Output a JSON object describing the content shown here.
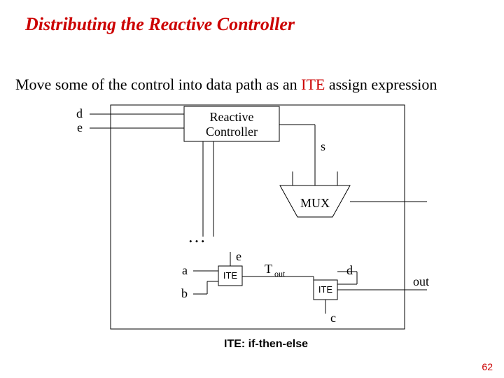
{
  "title": "Distributing the Reactive Controller",
  "subtitle_pre": "Move some of the control into data path as an ",
  "subtitle_ite": "ITE",
  "subtitle_post": " assign expression",
  "block_label1": "Reactive",
  "block_label2": "Controller",
  "mux_label": "MUX",
  "labels": {
    "d": "d",
    "e": "e",
    "s": "s",
    "dots": "…",
    "a": "a",
    "b": "b",
    "ite": "ITE",
    "lower_e": "e",
    "T": "T",
    "out_sub": "out",
    "right_d": "d",
    "out": "out",
    "c": "c"
  },
  "caption": "ITE: if-then-else",
  "page": "62"
}
